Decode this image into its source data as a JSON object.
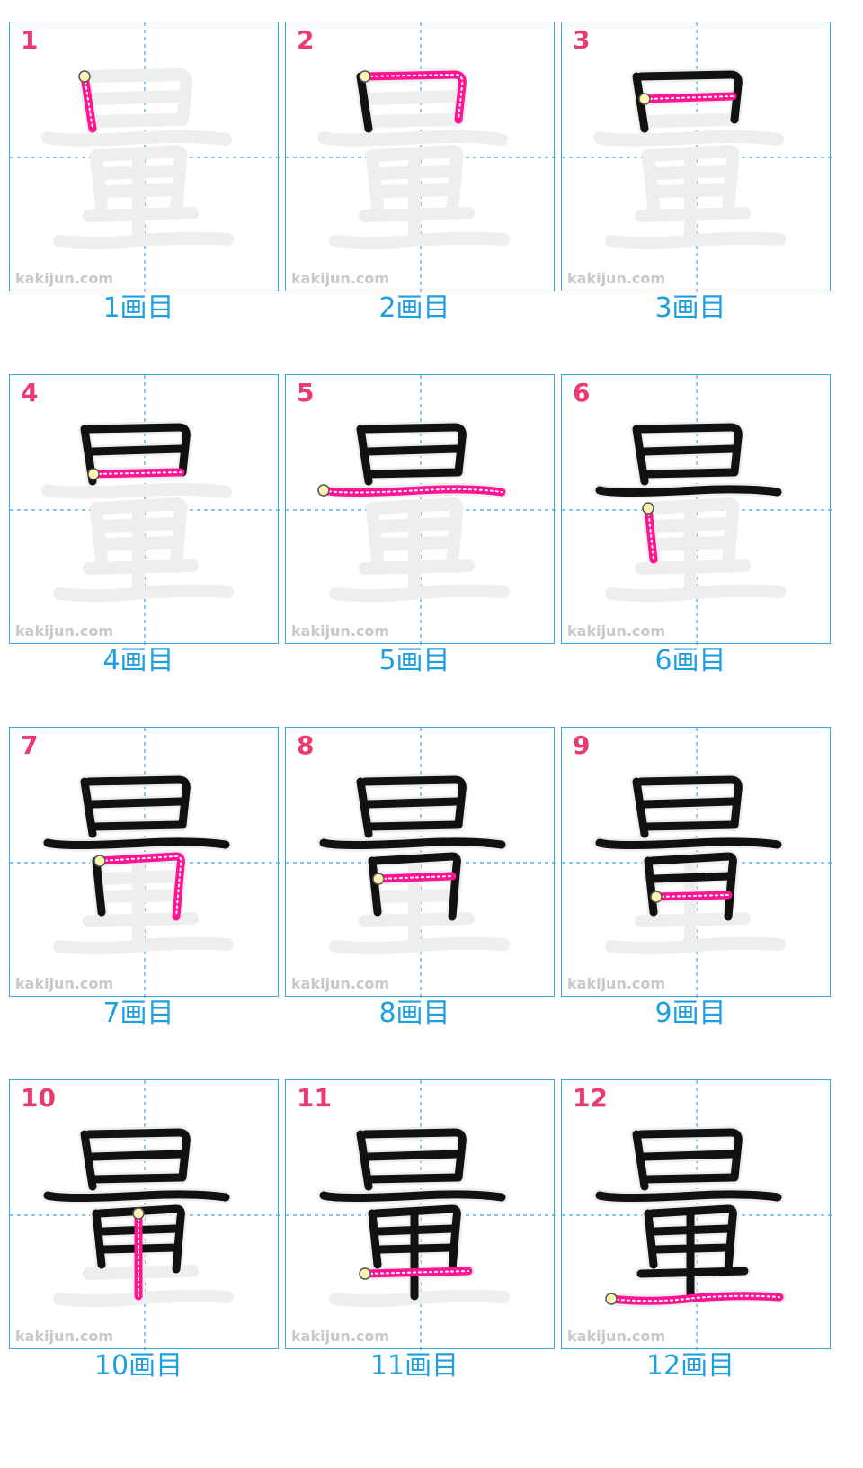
{
  "kanji": "量",
  "watermark": "kakijun.com",
  "colors": {
    "grid_border": "#3aa6dd",
    "guide_line": "#3aa6dd",
    "ghost": "#eeeeee",
    "done_stroke": "#111111",
    "active_stroke": "#ff1493",
    "step_number": "#ea3a6f",
    "caption": "#1f9fe0"
  },
  "steps": [
    {
      "number": "1",
      "caption": "1画目"
    },
    {
      "number": "2",
      "caption": "2画目"
    },
    {
      "number": "3",
      "caption": "3画目"
    },
    {
      "number": "4",
      "caption": "4画目"
    },
    {
      "number": "5",
      "caption": "5画目"
    },
    {
      "number": "6",
      "caption": "6画目"
    },
    {
      "number": "7",
      "caption": "7画目"
    },
    {
      "number": "8",
      "caption": "8画目"
    },
    {
      "number": "9",
      "caption": "9画目"
    },
    {
      "number": "10",
      "caption": "10画目"
    },
    {
      "number": "11",
      "caption": "11画目"
    },
    {
      "number": "12",
      "caption": "12画目"
    }
  ]
}
